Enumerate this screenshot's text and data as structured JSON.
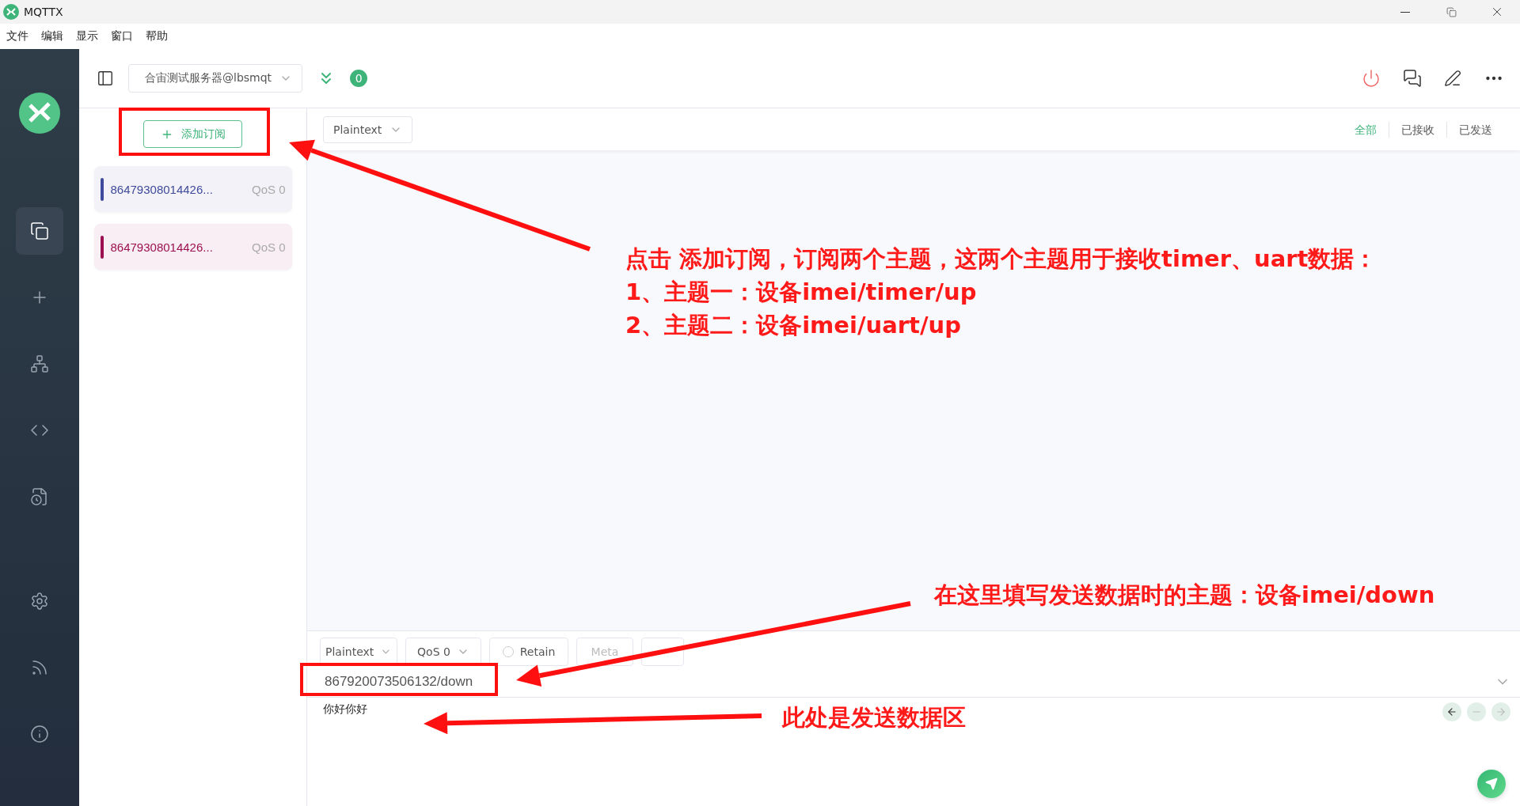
{
  "window": {
    "title": "MQTTX"
  },
  "menu": [
    "文件",
    "编辑",
    "显示",
    "窗口",
    "帮助"
  ],
  "nav": [
    {
      "kind": "connections",
      "selected": true
    },
    {
      "kind": "new",
      "selected": false
    },
    {
      "kind": "topology",
      "selected": false
    },
    {
      "kind": "script",
      "selected": false
    },
    {
      "kind": "log",
      "selected": false
    },
    {
      "kind": "settings",
      "selected": false
    },
    {
      "kind": "feed",
      "selected": false
    },
    {
      "kind": "about",
      "selected": false
    }
  ],
  "connection": {
    "name": "合宙测试服务器@lbsmqt",
    "unread": "0"
  },
  "subscriptions": {
    "add_button": "添加订阅",
    "items": [
      {
        "topic": "86479308014426...",
        "qos": "QoS 0",
        "color": "#3f4a9a"
      },
      {
        "topic": "86479308014426...",
        "qos": "QoS 0",
        "color": "#9b1050"
      }
    ]
  },
  "message_view": {
    "format": "Plaintext",
    "filters": [
      {
        "label": "全部",
        "selected": true
      },
      {
        "label": "已接收",
        "selected": false
      },
      {
        "label": "已发送",
        "selected": false
      }
    ]
  },
  "publish": {
    "format": "Plaintext",
    "qos": "QoS 0",
    "retain": {
      "label": "Retain",
      "checked": false
    },
    "meta": "Meta",
    "topic": "867920073506132/down",
    "payload": "你好你好"
  },
  "annotations": [
    {
      "lines": [
        "点击 添加订阅，订阅两个主题，这两个主题用于接收timer、uart数据：",
        "1、主题一：设备imei/timer/up",
        "2、主题二：设备imei/uart/up"
      ]
    },
    {
      "lines": [
        "在这里填写发送数据时的主题：设备imei/down"
      ]
    },
    {
      "lines": [
        "此处是发送数据区"
      ]
    }
  ]
}
